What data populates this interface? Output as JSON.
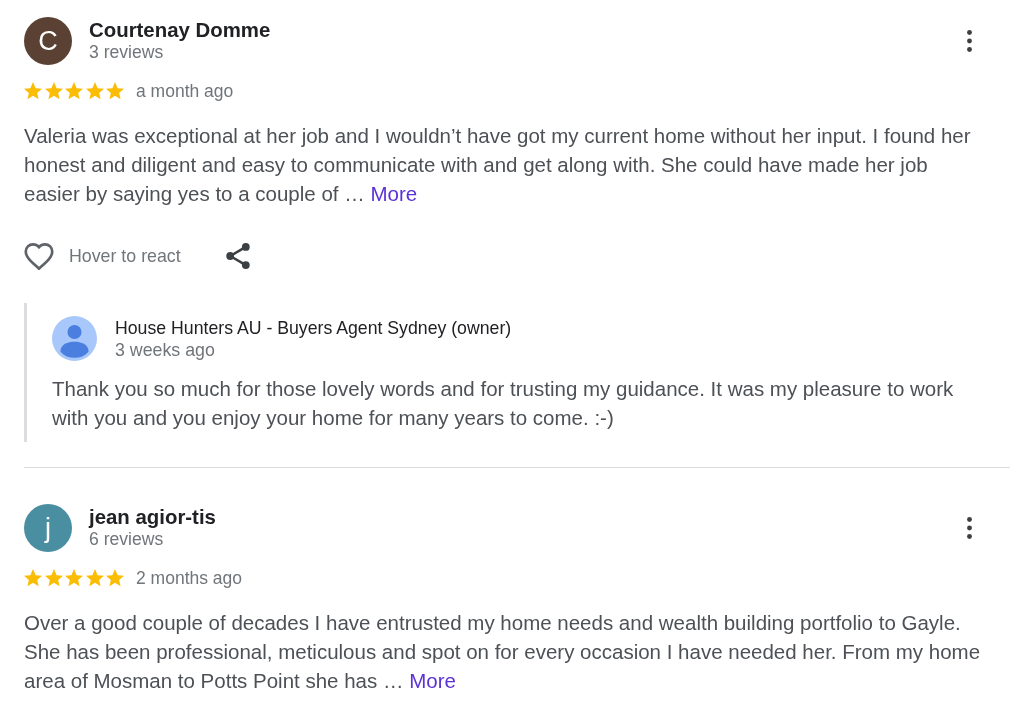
{
  "reviews": [
    {
      "avatar": {
        "letter": "C",
        "color": "#5b4133"
      },
      "name": "Courtenay Domme",
      "review_count": "3 reviews",
      "stars": 5,
      "time": "a month ago",
      "text": "Valeria was exceptional at her job and I wouldn’t have got my current home without her input. I found her honest and diligent and easy to communicate with and get along with. She could have made her job easier by saying yes to a couple of …",
      "more_link": "More",
      "actions": {
        "react_label": "Hover to react"
      },
      "owner_reply": {
        "name": "House Hunters AU - Buyers Agent Sydney (owner)",
        "time": "3 weeks ago",
        "text": "Thank you so much for those lovely words and for trusting my guidance. It was my pleasure to work with you and you enjoy your home for many years to come. :-)"
      }
    },
    {
      "avatar": {
        "letter": "j",
        "color": "#4a8fa1"
      },
      "name": "jean agior-tis",
      "review_count": "6 reviews",
      "stars": 5,
      "time": "2 months ago",
      "text": "Over a good couple of decades I have entrusted my home needs and wealth building portfolio to Gayle. She has been professional, meticulous and spot on for every occasion I have needed her. From my home area of Mosman to Potts Point she has …",
      "more_link": "More"
    }
  ]
}
